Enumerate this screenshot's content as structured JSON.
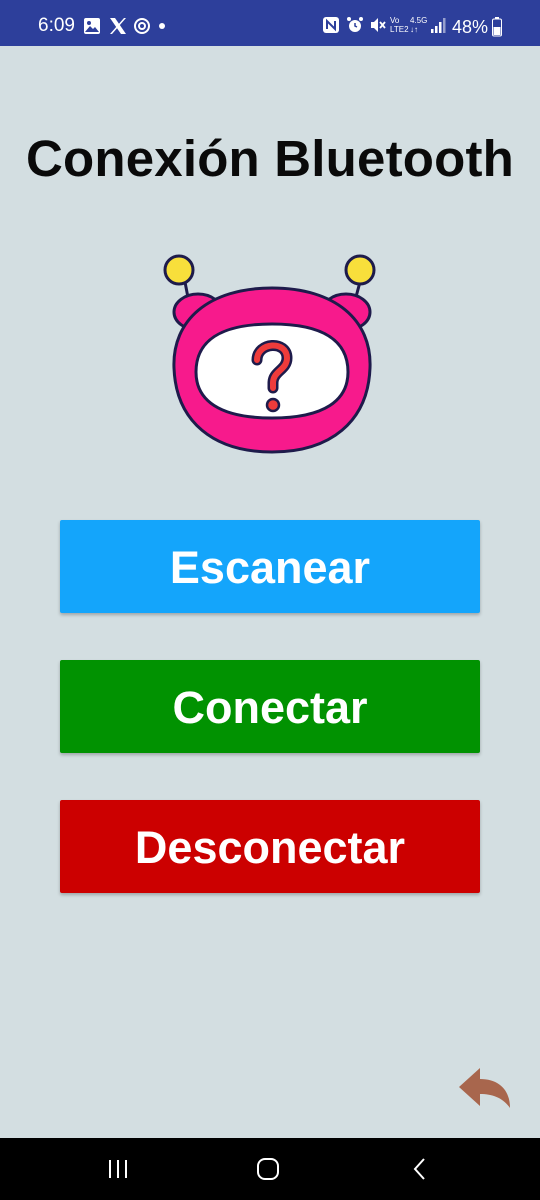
{
  "status_bar": {
    "time": "6:09",
    "battery": "48%",
    "left_icons": [
      "gallery-icon",
      "x-logo-icon",
      "sync-icon",
      "dot-icon"
    ],
    "right_icons": [
      "nfc-icon",
      "alarm-icon",
      "mute-icon",
      "volte-icon",
      "network-4-5g-icon",
      "signal-icon",
      "battery-icon"
    ],
    "volte_label_top": "Vo",
    "volte_label_bottom": "LTE2",
    "network_label": "4.5G",
    "background": "#2d3f9b"
  },
  "page": {
    "title": "Conexión Bluetooth",
    "background": "#d3dee1",
    "robot_icon": "robot-question-icon"
  },
  "buttons": {
    "scan": {
      "label": "Escanear",
      "color": "#14a5fb"
    },
    "connect": {
      "label": "Conectar",
      "color": "#019201"
    },
    "disconnect": {
      "label": "Desconectar",
      "color": "#cc0000"
    }
  },
  "back": {
    "icon": "back-arrow-icon",
    "color": "#a8664d"
  },
  "nav_bar": {
    "buttons": [
      "recent-apps-icon",
      "home-icon",
      "back-icon"
    ]
  }
}
